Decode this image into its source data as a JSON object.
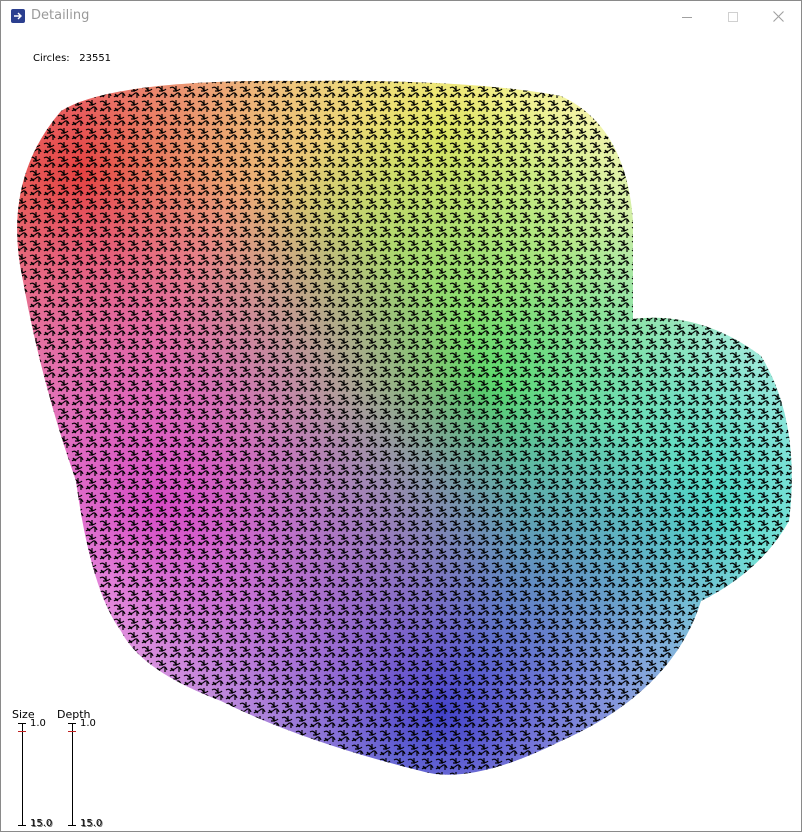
{
  "window": {
    "title": "Detailing",
    "controls": {
      "minimize": "—",
      "maximize": "☐",
      "close": "✕"
    }
  },
  "app_icon": "arrow-right-icon",
  "stats": {
    "circles_label": "Circles:",
    "circles_count": "23551"
  },
  "sliders": [
    {
      "label": "Size",
      "max_label": "1.0",
      "min_label": "15.0",
      "ghost_label": "15.0",
      "level": 0.08
    },
    {
      "label": "Depth",
      "max_label": "1.0",
      "min_label": "15.0",
      "ghost_label": "15.0",
      "level": 0.08
    }
  ],
  "colors": {
    "accent_thumb": "#c02020",
    "blob_red": "#e02020",
    "blob_orange": "#f09030",
    "blob_yellow": "#e8e850",
    "blob_green": "#40d040",
    "blob_cyan": "#30d0c0",
    "blob_blue": "#2020c0",
    "blob_magenta": "#d030c0"
  }
}
